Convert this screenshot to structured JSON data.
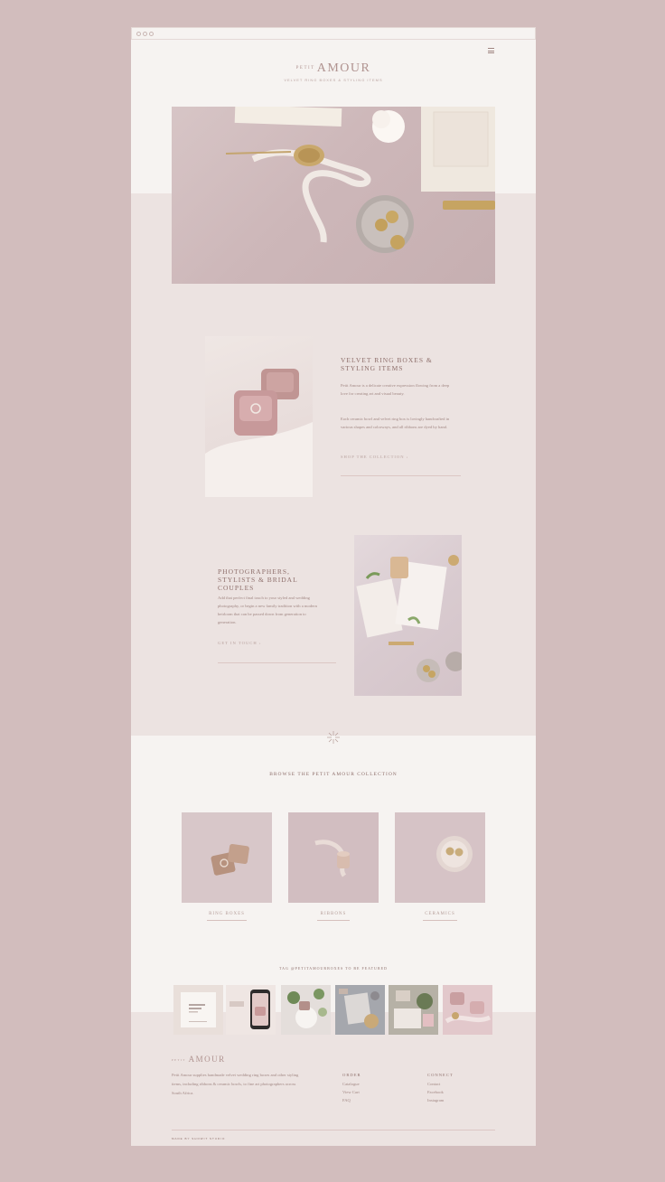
{
  "site": {
    "logo_small": "PETIT",
    "logo_main": "AMOUR",
    "tagline": "VELVET RING BOXES & STYLING ITEMS"
  },
  "feature1": {
    "title": "VELVET RING BOXES & STYLING ITEMS",
    "para1": "Petit Amour is a delicate creative expression flowing from a deep love for creating art and visual beauty.",
    "para2": "Each ceramic bowl and velvet ring box is lovingly handcrafted in various shapes and colorways, and all ribbons are dyed by hand.",
    "link": "SHOP THE COLLECTION"
  },
  "feature2": {
    "title": "PHOTOGRAPHERS, STYLISTS & BRIDAL COUPLES",
    "para": "Add that perfect final touch to your styled and wedding photography, or begin a new family tradition with a modern heirloom that can be passed down from generation to generation.",
    "link": "GET IN TOUCH"
  },
  "collection": {
    "title": "BROWSE THE PETIT AMOUR COLLECTION",
    "items": [
      "RING BOXES",
      "RIBBONS",
      "CERAMICS"
    ]
  },
  "instagram": {
    "title": "TAG @PETITAMOURBOXES TO BE FEATURED"
  },
  "footer": {
    "logo_small": "PETIT",
    "logo_main": "AMOUR",
    "description": "Petit Amour supplies handmade velvet wedding ring boxes and other styling items, including ribbons & ceramic bowls, to fine art photographers across South Africa.",
    "order_title": "ORDER",
    "order_links": [
      "Catalogue",
      "View Cart",
      "FAQ"
    ],
    "connect_title": "CONNECT",
    "connect_links": [
      "Contact",
      "Facebook",
      "Instagram"
    ],
    "credit": "MADE BY SHOWIT STUDIO"
  },
  "colors": {
    "background": "#d2bdbd",
    "page": "#f6f3f1",
    "band": "#ece3e1",
    "accent": "#8e6f6b"
  }
}
